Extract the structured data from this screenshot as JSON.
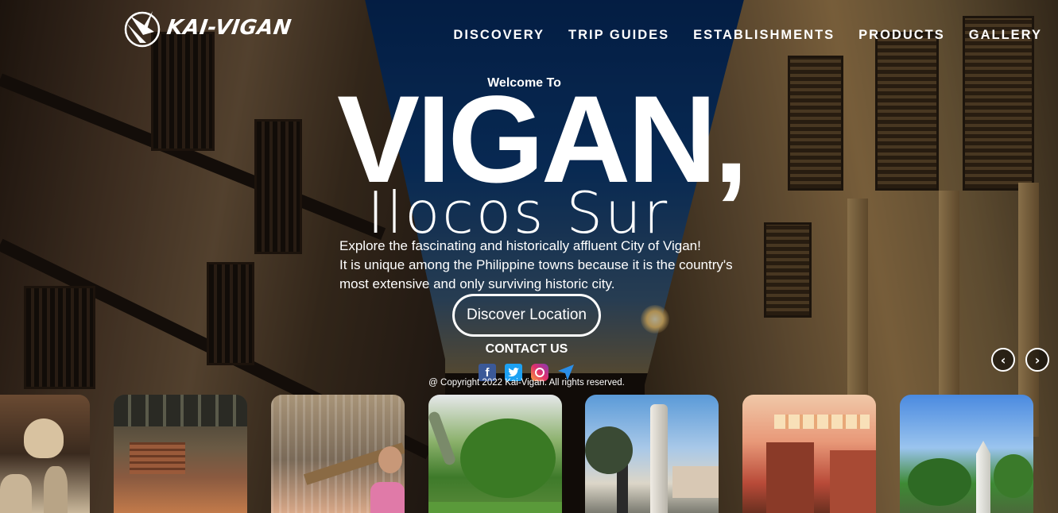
{
  "brand": {
    "name": "KAI-VIGAN"
  },
  "nav": {
    "items": [
      "DISCOVERY",
      "TRIP GUIDES",
      "ESTABLISHMENTS",
      "PRODUCTS",
      "GALLERY"
    ]
  },
  "hero": {
    "welcome": "Welcome To",
    "title": "VIGAN,",
    "subtitle": "Ilocos Sur",
    "description": [
      "Explore the fascinating and historically affluent City of Vigan!",
      "It is unique among the Philippine towns because it is the country's",
      "most extensive and only surviving historic city."
    ],
    "cta_label": "Discover Location"
  },
  "contact": {
    "heading": "CONTACT US",
    "socials": [
      {
        "icon": "facebook-icon",
        "glyph": "f"
      },
      {
        "icon": "twitter-icon",
        "glyph": "t"
      },
      {
        "icon": "instagram-icon",
        "glyph": ""
      },
      {
        "icon": "location-arrow-icon",
        "glyph": ""
      }
    ],
    "copyright": "@ Copyright 2022 Kai-Vigan. All rights reserved."
  },
  "carousel": {
    "prev_icon": "chevron-left-icon",
    "next_icon": "chevron-right-icon",
    "thumbnails": [
      "pottery-jars-photo",
      "brick-kiln-workshop-photo",
      "weaver-at-loom-photo",
      "dinosaur-park-photo",
      "plaza-monument-photo",
      "heritage-house-interior-photo",
      "plaza-obelisk-photo"
    ]
  },
  "colors": {
    "sky": "#062c63",
    "facebook": "#3b5998",
    "twitter": "#1da1f2",
    "text": "#ffffff"
  }
}
